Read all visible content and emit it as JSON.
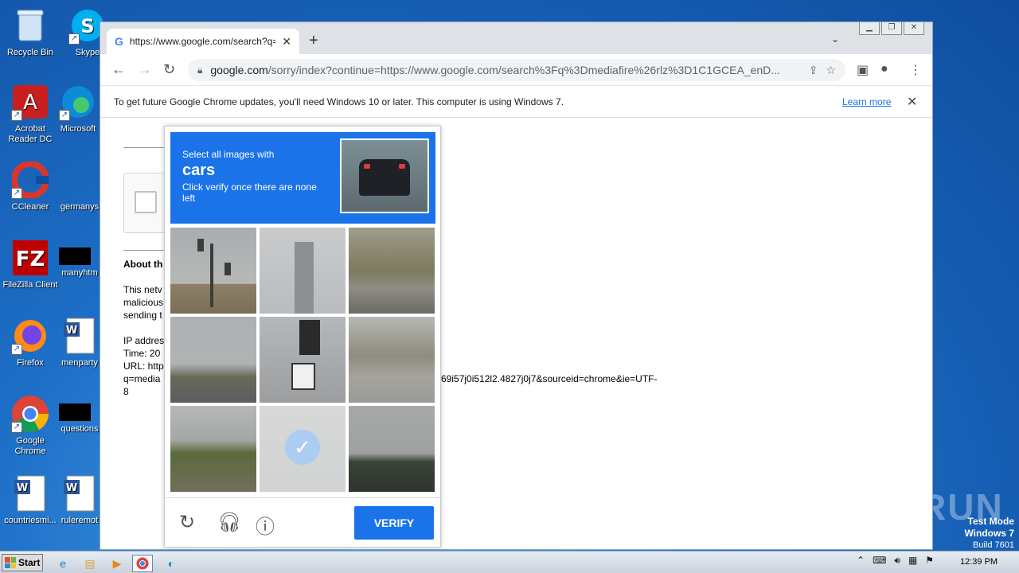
{
  "desktop": {
    "icons": [
      {
        "label": "Recycle Bin"
      },
      {
        "label": "Skype"
      },
      {
        "label": "Acrobat Reader DC"
      },
      {
        "label": "Microsoft"
      },
      {
        "label": "CCleaner"
      },
      {
        "label": "germanys"
      },
      {
        "label": "FileZilla Client"
      },
      {
        "label": "manyhtm"
      },
      {
        "label": "Firefox"
      },
      {
        "label": "menparty"
      },
      {
        "label": "Google Chrome"
      },
      {
        "label": "questions"
      },
      {
        "label": "countriesmi..."
      },
      {
        "label": "ruleremot"
      }
    ]
  },
  "browser": {
    "tab_title": "https://www.google.com/search?q=",
    "omnibox": {
      "host": "google.com",
      "path": "/sorry/index?continue=https://www.google.com/search%3Fq%3Dmediafire%26rlz%3D1C1GCEA_enD..."
    },
    "infobar": {
      "message": "To get future Google Chrome updates, you'll need Windows 10 or later. This computer is using Windows 7.",
      "link": "Learn more"
    }
  },
  "page": {
    "about_heading": "About th",
    "paragraph_lines": [
      "This netv",
      "malicious",
      "sending t"
    ],
    "ip_line": "IP addres",
    "time_line": "Time: 20",
    "url_line1": "URL: http",
    "url_line2": "q=media",
    "url_tail": "69i57j0i512l2.4827j0j7&sourceid=chrome&ie=UTF-",
    "url_line3": "8"
  },
  "captcha": {
    "line1": "Select all images with",
    "keyword": "cars",
    "line3": "Click verify once there are none left",
    "verify_label": "VERIFY",
    "selected_tile": 7
  },
  "taskbar": {
    "start_label": "Start",
    "clock": "12:39 PM"
  },
  "overlay": {
    "watermark": "ANY RUN",
    "test_mode": "Test Mode",
    "os": "Windows 7",
    "build": "Build 7601"
  }
}
